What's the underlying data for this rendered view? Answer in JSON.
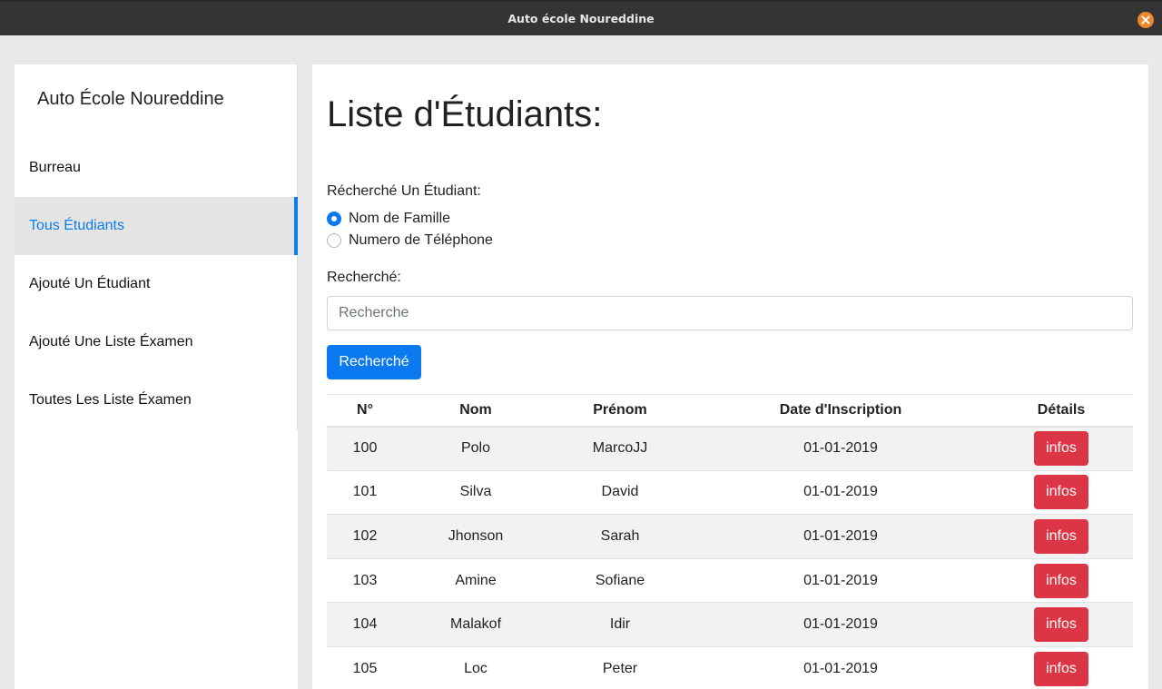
{
  "window": {
    "title": "Auto école Noureddine"
  },
  "sidebar": {
    "brand": "Auto École Noureddine",
    "items": [
      {
        "label": "Burreau"
      },
      {
        "label": "Tous Étudiants"
      },
      {
        "label": "Ajouté Un Étudiant"
      },
      {
        "label": "Ajouté Une Liste Éxamen"
      },
      {
        "label": "Toutes Les Liste Éxamen"
      }
    ]
  },
  "main": {
    "title": "Liste d'Étudiants:",
    "search_by_label": "Récherché Un Étudiant:",
    "radio_options": [
      {
        "label": "Nom de Famille",
        "checked": true
      },
      {
        "label": "Numero de Téléphone",
        "checked": false
      }
    ],
    "search_label": "Recherché:",
    "search_placeholder": "Recherche",
    "search_value": "",
    "search_button": "Recherché",
    "table": {
      "headers": [
        "N°",
        "Nom",
        "Prénom",
        "Date d'Inscription",
        "Détails"
      ],
      "rows": [
        {
          "num": "100",
          "nom": "Polo",
          "prenom": "MarcoJJ",
          "date": "01-01-2019",
          "details": "infos"
        },
        {
          "num": "101",
          "nom": "Silva",
          "prenom": "David",
          "date": "01-01-2019",
          "details": "infos"
        },
        {
          "num": "102",
          "nom": "Jhonson",
          "prenom": "Sarah",
          "date": "01-01-2019",
          "details": "infos"
        },
        {
          "num": "103",
          "nom": "Amine",
          "prenom": "Sofiane",
          "date": "01-01-2019",
          "details": "infos"
        },
        {
          "num": "104",
          "nom": "Malakof",
          "prenom": "Idir",
          "date": "01-01-2019",
          "details": "infos"
        },
        {
          "num": "105",
          "nom": "Loc",
          "prenom": "Peter",
          "date": "01-01-2019",
          "details": "infos"
        }
      ]
    }
  },
  "colors": {
    "accent": "#0b7af0",
    "danger": "#dc3545",
    "titlebar": "#343434",
    "close": "#f0862c"
  },
  "icons": {
    "close": "close-icon",
    "radio": "radio-icon"
  }
}
